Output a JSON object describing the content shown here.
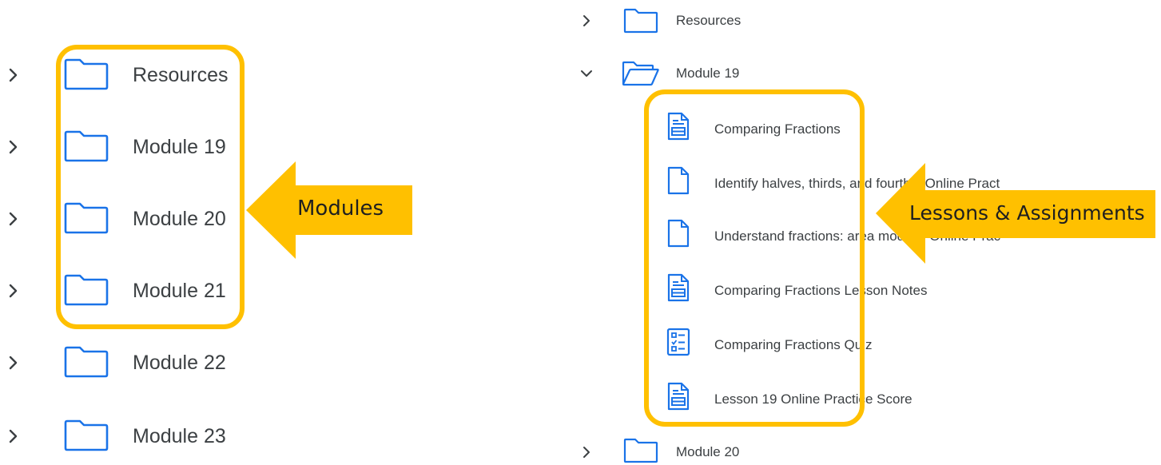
{
  "colors": {
    "accent": "#FFC000",
    "icon_blue": "#1a73e8",
    "text": "#3c4043"
  },
  "left_panel": {
    "items": [
      {
        "label": "Resources",
        "expanded": false,
        "icon": "folder-icon"
      },
      {
        "label": "Module 19",
        "expanded": false,
        "icon": "folder-icon"
      },
      {
        "label": "Module 20",
        "expanded": false,
        "icon": "folder-icon"
      },
      {
        "label": "Module 21",
        "expanded": false,
        "icon": "folder-icon"
      },
      {
        "label": "Module 22",
        "expanded": false,
        "icon": "folder-icon"
      },
      {
        "label": "Module 23",
        "expanded": false,
        "icon": "folder-icon"
      }
    ],
    "callout_label": "Modules"
  },
  "right_panel": {
    "items": [
      {
        "label": "Resources",
        "expanded": false,
        "icon": "folder-icon"
      },
      {
        "label": "Module 19",
        "expanded": true,
        "icon": "folder-open-icon"
      },
      {
        "label": "Module 20",
        "expanded": false,
        "icon": "folder-icon"
      }
    ],
    "children": [
      {
        "label": "Comparing Fractions",
        "icon": "assignment-icon"
      },
      {
        "label": "Identify halves, thirds, and fourths: Online Pract",
        "icon": "page-icon"
      },
      {
        "label": "Understand fractions: area models: Online Prac",
        "icon": "page-icon"
      },
      {
        "label": "Comparing Fractions Lesson Notes",
        "icon": "assignment-icon"
      },
      {
        "label": "Comparing Fractions Quiz",
        "icon": "quiz-icon"
      },
      {
        "label": "Lesson 19 Online Practice Score",
        "icon": "assignment-icon"
      }
    ],
    "callout_label": "Lessons & Assignments"
  }
}
